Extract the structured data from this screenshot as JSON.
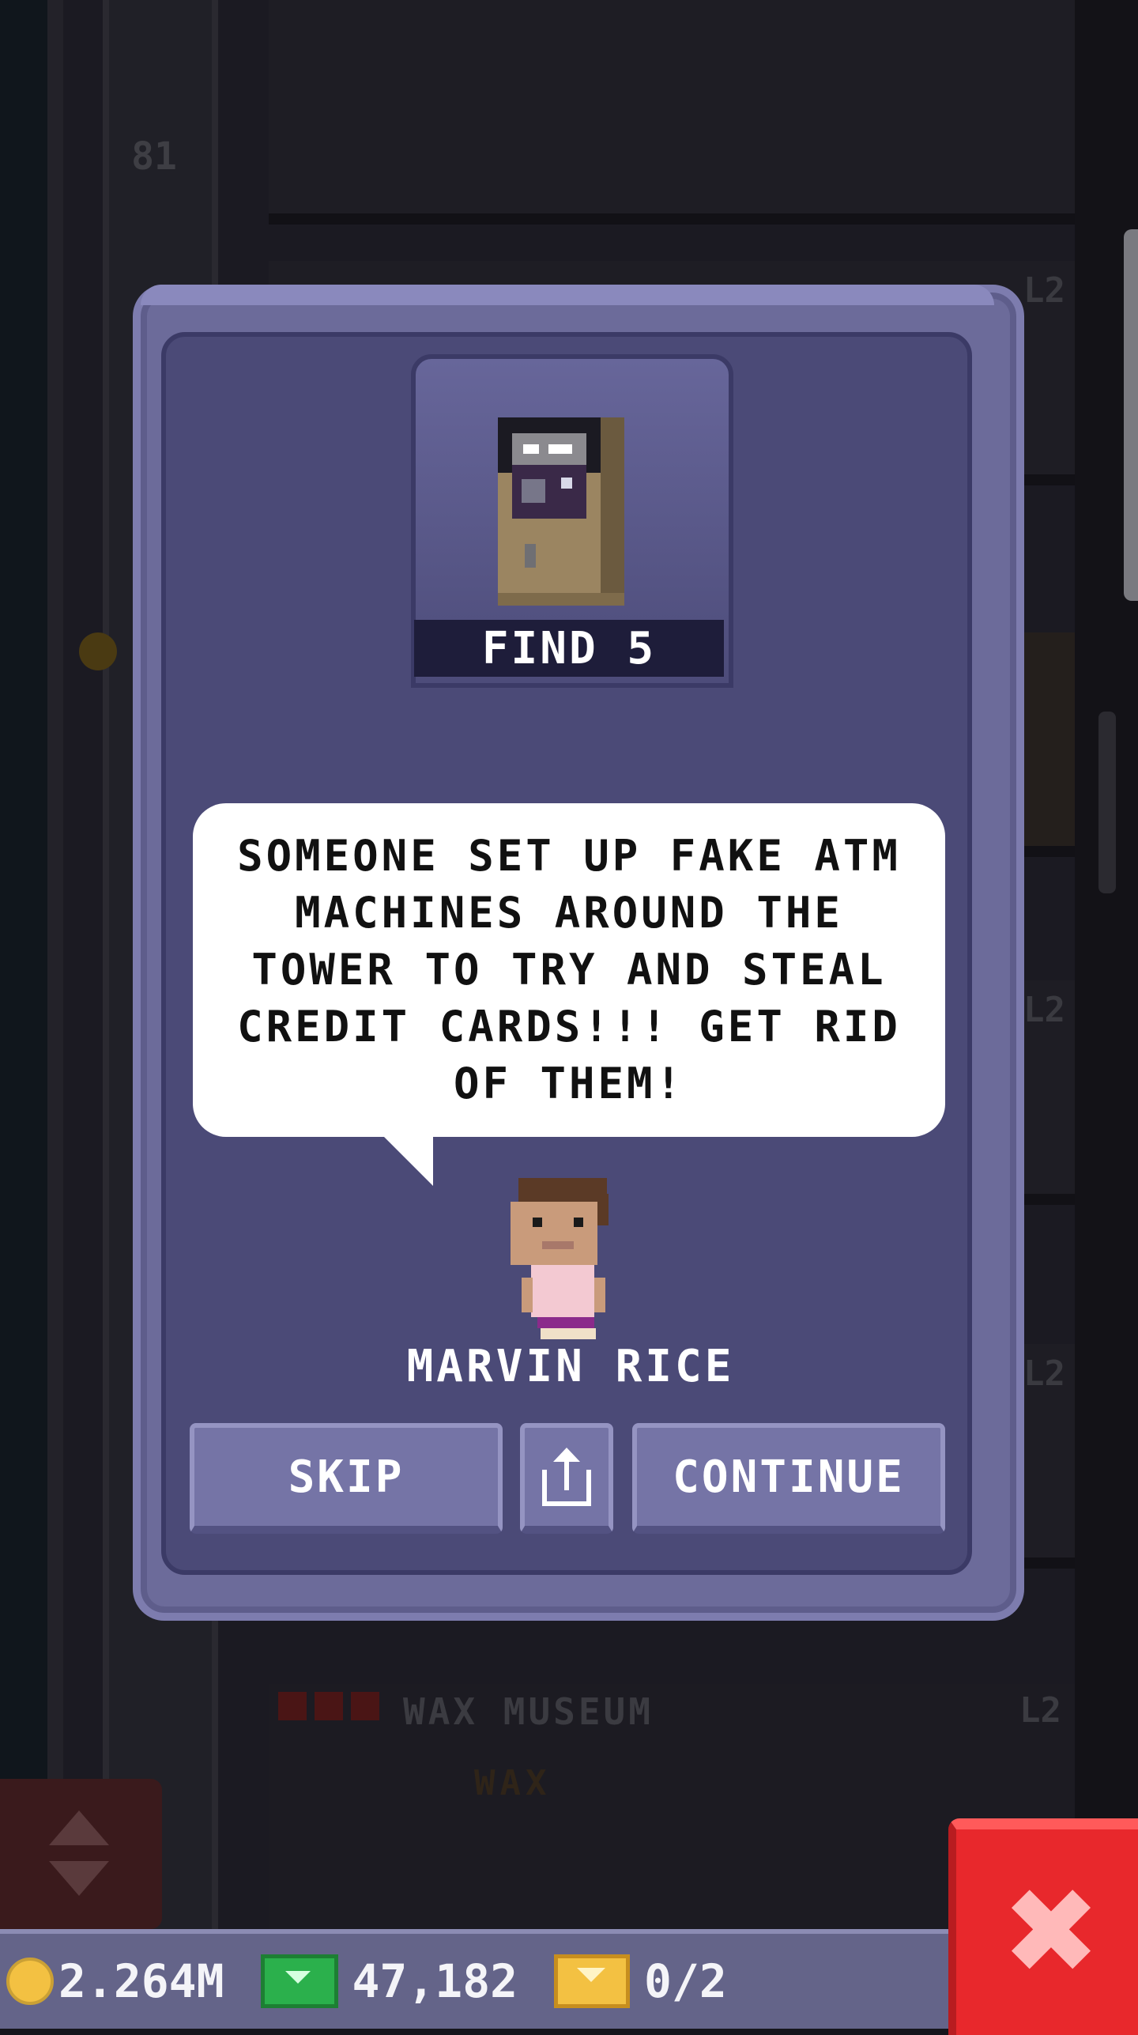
{
  "background": {
    "floor_number": "81",
    "floor_tag": "L2",
    "wax_floor_name": "WAX MUSEUM",
    "wax_floor_tag": "L2",
    "wax_sign": "WAX"
  },
  "dialog": {
    "find_label": "FIND 5",
    "mission_text": "SOMEONE SET UP FAKE ATM MACHINES AROUND THE TOWER TO TRY AND STEAL CREDIT CARDS!!! GET RID OF THEM!",
    "character_name": "MARVIN RICE",
    "skip_label": "SKIP",
    "continue_label": "CONTINUE",
    "share_icon": "share-icon",
    "mission_icon": "atm-icon"
  },
  "status_bar": {
    "coins": "2.264M",
    "bux": "47,182",
    "tickets": "0/2"
  },
  "colors": {
    "dialog_bg": "#6c6b9a",
    "dialog_inner": "#4b4a77",
    "button": "#7574a6",
    "close_button": "#e8282c",
    "status_bar": "#646489"
  }
}
